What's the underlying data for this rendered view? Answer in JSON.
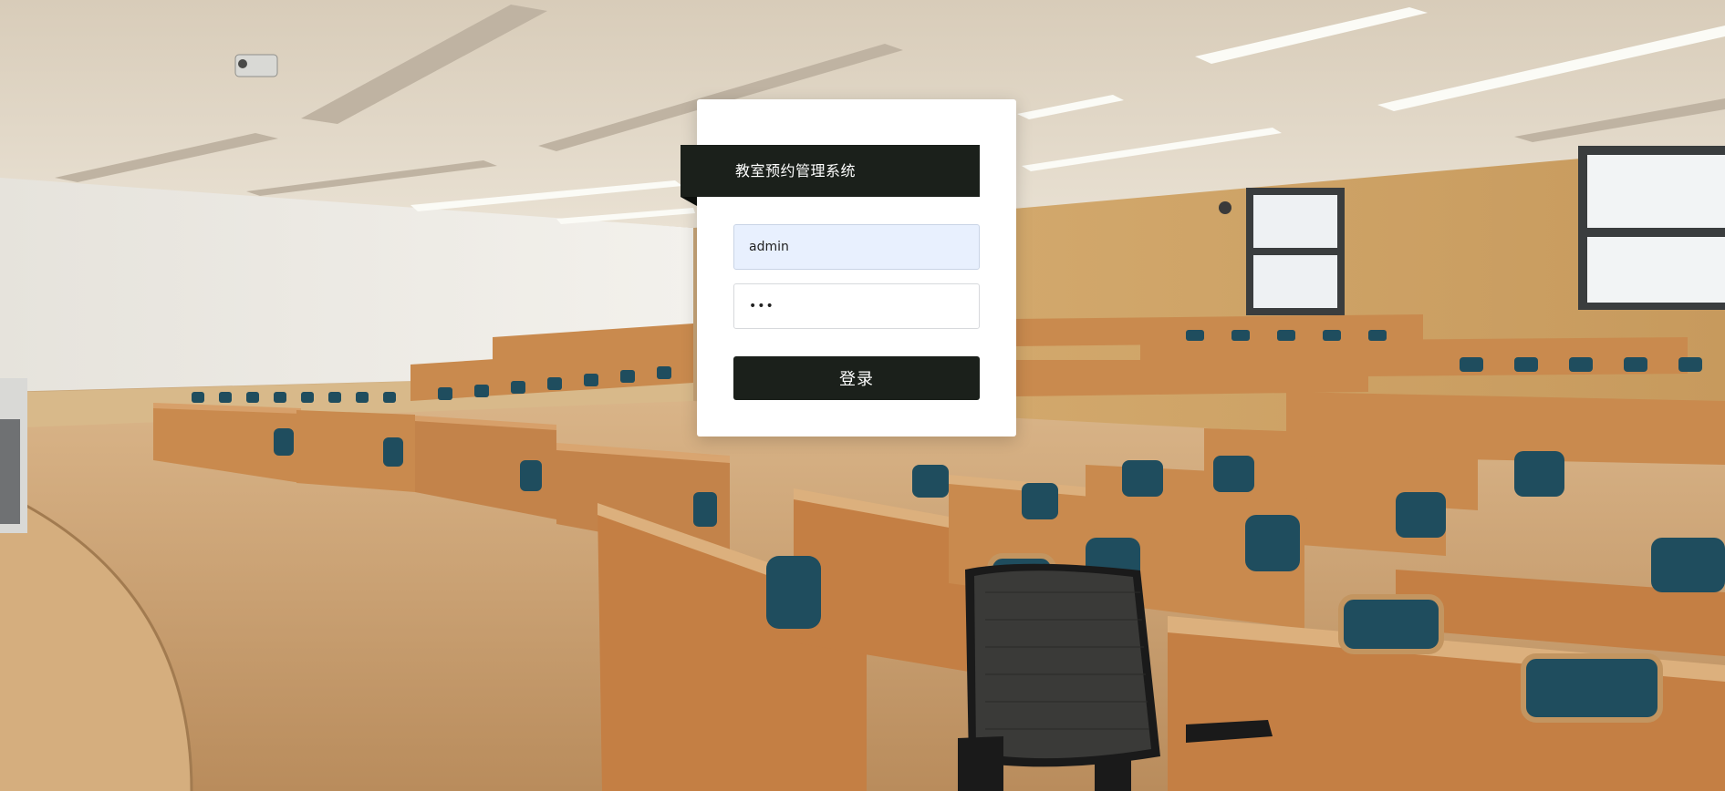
{
  "login": {
    "title": "教室预约管理系统",
    "username_value": "admin",
    "password_value": "•••",
    "submit_label": "登录"
  },
  "colors": {
    "card_bg": "#ffffff",
    "ribbon_bg": "#1b201b",
    "button_bg": "#1b201b",
    "username_autofill_bg": "#e8f0fe",
    "wall_beige": "#d7c3a3",
    "desk_wood": "#c9874e",
    "seat_blue": "#1f4d5e",
    "floor_wood": "#cfa676"
  },
  "icons": {
    "camera": "security-camera-icon",
    "decor": "lecture-hall-background"
  }
}
